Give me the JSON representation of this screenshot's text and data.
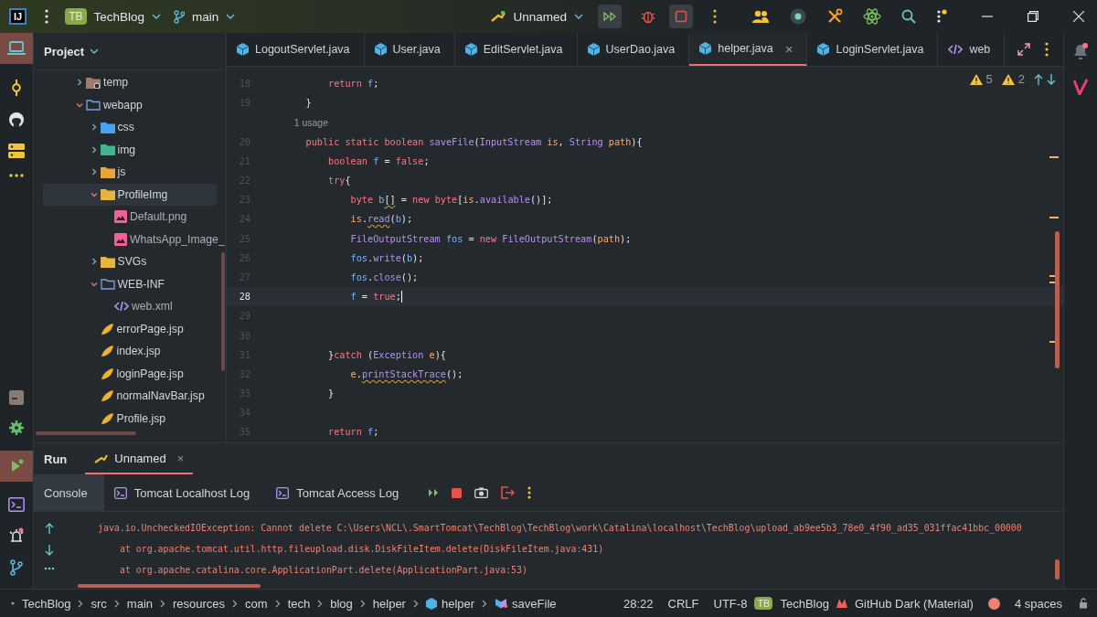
{
  "title_bar": {
    "logo": "IJ",
    "project_badge": "TB",
    "project": "TechBlog",
    "branch": "main",
    "run_config": "Unnamed"
  },
  "project_panel": {
    "title": "Project",
    "tree": [
      {
        "label": "temp",
        "kind": "folder-clock",
        "expanded": false,
        "selected": false
      },
      {
        "label": "webapp",
        "kind": "folder",
        "expanded": true,
        "selected": false,
        "children": [
          {
            "label": "css",
            "kind": "folder-css",
            "expanded": false,
            "selected": false
          },
          {
            "label": "img",
            "kind": "folder-img",
            "expanded": false,
            "selected": false
          },
          {
            "label": "js",
            "kind": "folder-js",
            "expanded": false,
            "selected": false
          },
          {
            "label": "ProfileImg",
            "kind": "folder-res",
            "expanded": true,
            "selected": true,
            "children": [
              {
                "label": "Default.png",
                "kind": "image",
                "selected": false
              },
              {
                "label": "WhatsApp_Image_",
                "kind": "image",
                "selected": false
              }
            ]
          },
          {
            "label": "SVGs",
            "kind": "folder-res",
            "expanded": false,
            "selected": false
          },
          {
            "label": "WEB-INF",
            "kind": "folder",
            "expanded": true,
            "selected": false,
            "children": [
              {
                "label": "web.xml",
                "kind": "xml",
                "selected": false
              }
            ]
          },
          {
            "label": "errorPage.jsp",
            "kind": "jsp",
            "selected": false
          },
          {
            "label": "index.jsp",
            "kind": "jsp",
            "selected": false
          },
          {
            "label": "loginPage.jsp",
            "kind": "jsp",
            "selected": false
          },
          {
            "label": "normalNavBar.jsp",
            "kind": "jsp",
            "selected": false
          },
          {
            "label": "Profile.jsp",
            "kind": "jsp",
            "selected": false
          }
        ]
      }
    ]
  },
  "editor": {
    "tabs": [
      {
        "label": "LogoutServlet.java",
        "kind": "java",
        "selected": false
      },
      {
        "label": "User.java",
        "kind": "java",
        "selected": false
      },
      {
        "label": "EditServlet.java",
        "kind": "java",
        "selected": false
      },
      {
        "label": "UserDao.java",
        "kind": "java",
        "selected": false
      },
      {
        "label": "helper.java",
        "kind": "java",
        "selected": true,
        "close": "×"
      },
      {
        "label": "LoginServlet.java",
        "kind": "java",
        "selected": false
      },
      {
        "label": "web",
        "kind": "xml",
        "selected": false
      }
    ],
    "warnings": [
      "5",
      "2"
    ],
    "lines": [
      {
        "kind": "code",
        "number": "18",
        "current": false,
        "tokens": [
          {
            "kind": "keyword",
            "text": "        return"
          },
          {
            "kind": "variable",
            "text": " f"
          },
          {
            "kind": "plain",
            "text": ";"
          }
        ]
      },
      {
        "kind": "code",
        "number": "19",
        "current": false,
        "tokens": [
          {
            "kind": "plain",
            "text": "    }"
          }
        ]
      },
      {
        "kind": "hint",
        "text": "    1 usage"
      },
      {
        "kind": "code",
        "number": "20",
        "current": false,
        "tokens": [
          {
            "kind": "keyword",
            "text": "    public static boolean"
          },
          {
            "kind": "method",
            "text": " saveFile"
          },
          {
            "kind": "plain",
            "text": "("
          },
          {
            "kind": "type",
            "text": "InputStream"
          },
          {
            "kind": "param",
            "text": " is"
          },
          {
            "kind": "plain",
            "text": ", "
          },
          {
            "kind": "type",
            "text": "String"
          },
          {
            "kind": "param",
            "text": " path"
          },
          {
            "kind": "plain",
            "text": "){"
          }
        ]
      },
      {
        "kind": "code",
        "number": "21",
        "current": false,
        "tokens": [
          {
            "kind": "keyword",
            "text": "        boolean"
          },
          {
            "kind": "variable",
            "text": " f"
          },
          {
            "kind": "plain",
            "text": " = "
          },
          {
            "kind": "keyword",
            "text": "false"
          },
          {
            "kind": "plain",
            "text": ";"
          }
        ]
      },
      {
        "kind": "code",
        "number": "22",
        "current": false,
        "tokens": [
          {
            "kind": "keyword",
            "text": "        try"
          },
          {
            "kind": "plain",
            "text": "{"
          }
        ]
      },
      {
        "kind": "code",
        "number": "23",
        "current": false,
        "tokens": [
          {
            "kind": "keyword",
            "text": "            byte"
          },
          {
            "kind": "variable",
            "text": " b"
          },
          {
            "kind": "plain",
            "text": "[]",
            "squiggle": true
          },
          {
            "kind": "plain",
            "text": " = "
          },
          {
            "kind": "keyword",
            "text": "new byte"
          },
          {
            "kind": "plain",
            "text": "["
          },
          {
            "kind": "param",
            "text": "is"
          },
          {
            "kind": "plain",
            "text": "."
          },
          {
            "kind": "method",
            "text": "available"
          },
          {
            "kind": "plain",
            "text": "()];"
          }
        ]
      },
      {
        "kind": "code",
        "number": "24",
        "current": false,
        "tokens": [
          {
            "kind": "param",
            "text": "            is"
          },
          {
            "kind": "plain",
            "text": "."
          },
          {
            "kind": "method",
            "text": "read",
            "squiggle": true
          },
          {
            "kind": "plain",
            "text": "("
          },
          {
            "kind": "variable",
            "text": "b"
          },
          {
            "kind": "plain",
            "text": ");"
          }
        ]
      },
      {
        "kind": "code",
        "number": "25",
        "current": false,
        "tokens": [
          {
            "kind": "type",
            "text": "            FileOutputStream"
          },
          {
            "kind": "variable",
            "text": " fos"
          },
          {
            "kind": "plain",
            "text": " = "
          },
          {
            "kind": "keyword",
            "text": "new"
          },
          {
            "kind": "type",
            "text": " FileOutputStream"
          },
          {
            "kind": "plain",
            "text": "("
          },
          {
            "kind": "param",
            "text": "path"
          },
          {
            "kind": "plain",
            "text": ");"
          }
        ]
      },
      {
        "kind": "code",
        "number": "26",
        "current": false,
        "tokens": [
          {
            "kind": "variable",
            "text": "            fos"
          },
          {
            "kind": "plain",
            "text": "."
          },
          {
            "kind": "method",
            "text": "write"
          },
          {
            "kind": "plain",
            "text": "("
          },
          {
            "kind": "variable",
            "text": "b"
          },
          {
            "kind": "plain",
            "text": ");"
          }
        ]
      },
      {
        "kind": "code",
        "number": "27",
        "current": false,
        "tokens": [
          {
            "kind": "variable",
            "text": "            fos"
          },
          {
            "kind": "plain",
            "text": "."
          },
          {
            "kind": "method",
            "text": "close"
          },
          {
            "kind": "plain",
            "text": "();"
          }
        ]
      },
      {
        "kind": "code",
        "number": "28",
        "current": true,
        "tokens": [
          {
            "kind": "variable",
            "text": "            f"
          },
          {
            "kind": "plain",
            "text": " = "
          },
          {
            "kind": "keyword",
            "text": "true"
          },
          {
            "kind": "plain",
            "text": ";"
          }
        ]
      },
      {
        "kind": "code",
        "number": "29",
        "current": false
      },
      {
        "kind": "code",
        "number": "30",
        "current": false
      },
      {
        "kind": "code",
        "number": "31",
        "current": false,
        "tokens": [
          {
            "kind": "plain",
            "text": "        }"
          },
          {
            "kind": "keyword",
            "text": "catch"
          },
          {
            "kind": "plain",
            "text": " ("
          },
          {
            "kind": "type",
            "text": "Exception"
          },
          {
            "kind": "param",
            "text": " e"
          },
          {
            "kind": "plain",
            "text": "){"
          }
        ]
      },
      {
        "kind": "code",
        "number": "32",
        "current": false,
        "tokens": [
          {
            "kind": "param",
            "text": "            e"
          },
          {
            "kind": "plain",
            "text": "."
          },
          {
            "kind": "method",
            "text": "printStackTrace",
            "squiggle": true
          },
          {
            "kind": "plain",
            "text": "();"
          }
        ]
      },
      {
        "kind": "code",
        "number": "33",
        "current": false,
        "tokens": [
          {
            "kind": "plain",
            "text": "        }"
          }
        ]
      },
      {
        "kind": "code",
        "number": "34",
        "current": false
      },
      {
        "kind": "code",
        "number": "35",
        "current": false,
        "tokens": [
          {
            "kind": "keyword",
            "text": "        return"
          },
          {
            "kind": "variable",
            "text": " f"
          },
          {
            "kind": "plain",
            "text": ";"
          }
        ]
      }
    ]
  },
  "run_panel": {
    "title": "Run",
    "tab": "Unnamed",
    "tab_close": "×",
    "subtabs": [
      {
        "label": "Console",
        "kind": "console",
        "selected": true
      },
      {
        "label": "Tomcat Localhost Log",
        "kind": "log",
        "selected": false
      },
      {
        "label": "Tomcat Access Log",
        "kind": "log",
        "selected": false
      }
    ],
    "console": [
      {
        "kind": "exception",
        "text": "java.io.UncheckedIOException: Cannot delete C:\\Users\\NCL\\.SmartTomcat\\TechBlog\\TechBlog\\work\\Catalina\\localhost\\TechBlog\\upload_ab9ee5b3_78e0_4f90_ad35_031ffac41bbc_00000"
      },
      {
        "kind": "frame",
        "text": "at org.apache.tomcat.util.http.fileupload.disk.DiskFileItem.delete(DiskFileItem.java:431)"
      },
      {
        "kind": "frame",
        "text": "at org.apache.catalina.core.ApplicationPart.delete(ApplicationPart.java:53)"
      }
    ]
  },
  "status_bar": {
    "breadcrumbs": [
      {
        "label": "TechBlog",
        "kind": "module"
      },
      {
        "label": "src",
        "kind": "folder"
      },
      {
        "label": "main",
        "kind": "folder"
      },
      {
        "label": "resources",
        "kind": "folder"
      },
      {
        "label": "com",
        "kind": "folder"
      },
      {
        "label": "tech",
        "kind": "folder"
      },
      {
        "label": "blog",
        "kind": "folder"
      },
      {
        "label": "helper",
        "kind": "folder"
      },
      {
        "label": "helper",
        "kind": "class"
      },
      {
        "label": "saveFile",
        "kind": "method"
      }
    ],
    "position": "28:22",
    "line_ending": "CRLF",
    "encoding": "UTF-8",
    "project_badge": "TB",
    "project": "TechBlog",
    "theme": "GitHub Dark (Material)",
    "indent": "4 spaces"
  }
}
